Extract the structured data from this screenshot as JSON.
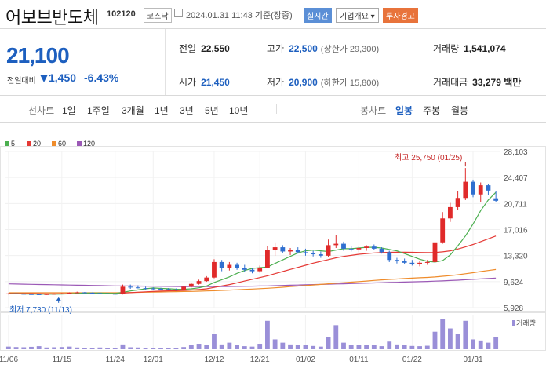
{
  "header": {
    "name": "어보브반도체",
    "code": "102120",
    "market": "코스닥",
    "datetime": "2024.01.31 11:43 기준(장중)",
    "realtime_label": "실시간",
    "company_label": "기업개요 ▾",
    "warning_label": "투자경고"
  },
  "quote": {
    "price": "21,100",
    "change_label": "전일대비",
    "change_value": "1,450",
    "change_pct": "-6.43%",
    "prev_label": "전일",
    "prev_value": "22,550",
    "high_label": "고가",
    "high_value": "22,500",
    "high_sub": "(상한가 29,300)",
    "volume_label": "거래량",
    "volume_value": "1,541,074",
    "open_label": "시가",
    "open_value": "21,450",
    "low_label": "저가",
    "low_value": "20,900",
    "low_sub": "(하한가 15,800)",
    "amount_label": "거래대금",
    "amount_value": "33,279 백만"
  },
  "tabs": {
    "line_label": "선차트",
    "periods": [
      "1일",
      "1주일",
      "3개월",
      "1년",
      "3년",
      "5년",
      "10년"
    ],
    "candle_label": "봉차트",
    "candle_types": [
      "일봉",
      "주봉",
      "월봉"
    ],
    "active_candle": "일봉"
  },
  "chart_data": {
    "type": "candlestick",
    "legend": [
      {
        "name": "5",
        "color": "#4caf50"
      },
      {
        "name": "20",
        "color": "#e53935"
      },
      {
        "name": "60",
        "color": "#ef8c2b"
      },
      {
        "name": "120",
        "color": "#9b59b6"
      }
    ],
    "y_ticks": [
      "28,103",
      "24,407",
      "20,711",
      "17,016",
      "13,320",
      "9,624",
      "5,928"
    ],
    "ylim": [
      5928,
      28103
    ],
    "x_ticks": [
      "11/06",
      "11/15",
      "11/24",
      "12/01",
      "12/12",
      "12/21",
      "01/02",
      "01/11",
      "01/22",
      "01/31"
    ],
    "volume_label": "거래량",
    "annotation_high": "최고 25,750 (01/25)",
    "annotation_low": "최저 7,730 (11/13)",
    "candles": [
      [
        7900,
        8000,
        7800,
        7950
      ],
      [
        7950,
        8000,
        7850,
        7900
      ],
      [
        7900,
        7950,
        7800,
        7850
      ],
      [
        7850,
        7900,
        7780,
        7830
      ],
      [
        7830,
        7880,
        7730,
        7800
      ],
      [
        7800,
        7900,
        7750,
        7850
      ],
      [
        7850,
        7950,
        7800,
        7900
      ],
      [
        7900,
        8000,
        7850,
        7950
      ],
      [
        7950,
        8100,
        7900,
        8050
      ],
      [
        8050,
        8200,
        8000,
        8100
      ],
      [
        8100,
        8150,
        8000,
        8050
      ],
      [
        8050,
        8100,
        7950,
        8000
      ],
      [
        8000,
        8050,
        7900,
        7950
      ],
      [
        7950,
        8000,
        7850,
        7900
      ],
      [
        7900,
        7950,
        7800,
        7850
      ],
      [
        7850,
        9200,
        7800,
        8900
      ],
      [
        8900,
        9200,
        8600,
        8800
      ],
      [
        8800,
        9100,
        8650,
        8700
      ],
      [
        8700,
        8900,
        8500,
        8650
      ],
      [
        8650,
        8800,
        8500,
        8600
      ],
      [
        8600,
        8750,
        8450,
        8550
      ],
      [
        8550,
        8700,
        8400,
        8500
      ],
      [
        8500,
        8650,
        8350,
        8450
      ],
      [
        8450,
        9000,
        8400,
        8900
      ],
      [
        8900,
        9500,
        8800,
        9300
      ],
      [
        9300,
        9900,
        9200,
        9700
      ],
      [
        9700,
        10400,
        9600,
        10200
      ],
      [
        10200,
        12800,
        10100,
        12400
      ],
      [
        12400,
        12700,
        11100,
        11500
      ],
      [
        11500,
        12400,
        11200,
        12000
      ],
      [
        12000,
        12300,
        11300,
        11600
      ],
      [
        11600,
        12000,
        11000,
        11300
      ],
      [
        11300,
        11600,
        10800,
        11100
      ],
      [
        11100,
        11900,
        10900,
        11600
      ],
      [
        11600,
        14700,
        11500,
        14100
      ],
      [
        14100,
        15200,
        13300,
        14500
      ],
      [
        14500,
        14800,
        13700,
        13900
      ],
      [
        13900,
        14400,
        13400,
        14100
      ],
      [
        14100,
        14500,
        13600,
        13800
      ],
      [
        13800,
        14300,
        13300,
        13700
      ],
      [
        13700,
        14000,
        13200,
        13500
      ],
      [
        13500,
        13900,
        13000,
        13300
      ],
      [
        13300,
        15600,
        13100,
        14800
      ],
      [
        14800,
        16200,
        14400,
        15000
      ],
      [
        15000,
        15300,
        14000,
        14300
      ],
      [
        14300,
        14700,
        13900,
        14200
      ],
      [
        14200,
        14600,
        13800,
        14400
      ],
      [
        14400,
        14800,
        14000,
        14600
      ],
      [
        14600,
        14900,
        14100,
        14300
      ],
      [
        14300,
        14500,
        13600,
        13800
      ],
      [
        13800,
        14000,
        12400,
        12700
      ],
      [
        12700,
        13000,
        12200,
        12500
      ],
      [
        12500,
        12900,
        12100,
        12300
      ],
      [
        12300,
        12700,
        11900,
        12100
      ],
      [
        12100,
        12600,
        11800,
        12300
      ],
      [
        12300,
        12700,
        12000,
        12400
      ],
      [
        12400,
        15600,
        12200,
        15200
      ],
      [
        15200,
        19500,
        15000,
        18600
      ],
      [
        18600,
        20800,
        18100,
        20200
      ],
      [
        20200,
        22500,
        19800,
        21500
      ],
      [
        21500,
        25750,
        21200,
        23800
      ],
      [
        23800,
        24100,
        21600,
        22000
      ],
      [
        22000,
        23700,
        20900,
        23300
      ],
      [
        23300,
        23500,
        21900,
        22550
      ],
      [
        21450,
        22500,
        20900,
        21100
      ]
    ],
    "ma5": [
      7900,
      7900,
      7880,
      7870,
      7850,
      7840,
      7845,
      7860,
      7900,
      7960,
      8000,
      8010,
      8000,
      7980,
      7950,
      8100,
      8300,
      8450,
      8600,
      8730,
      8660,
      8610,
      8550,
      8540,
      8600,
      8750,
      9000,
      9500,
      9900,
      10300,
      10800,
      11200,
      11500,
      11600,
      11700,
      12200,
      12700,
      13200,
      13700,
      14000,
      14100,
      14000,
      13900,
      14100,
      14300,
      14300,
      14400,
      14500,
      14500,
      14400,
      14200,
      14000,
      13600,
      13200,
      12800,
      12500,
      12400,
      12600,
      13400,
      14700,
      16100,
      17800,
      19700,
      21200,
      22300
    ],
    "ma20": [
      7950,
      7940,
      7930,
      7920,
      7910,
      7900,
      7900,
      7900,
      7910,
      7920,
      7930,
      7940,
      7950,
      7950,
      7950,
      8000,
      8060,
      8120,
      8180,
      8240,
      8280,
      8310,
      8340,
      8380,
      8430,
      8500,
      8600,
      8800,
      9000,
      9200,
      9450,
      9700,
      9950,
      10200,
      10450,
      10750,
      11050,
      11350,
      11650,
      11950,
      12250,
      12500,
      12750,
      13000,
      13200,
      13350,
      13500,
      13600,
      13700,
      13750,
      13780,
      13800,
      13800,
      13780,
      13760,
      13740,
      13760,
      13850,
      14000,
      14250,
      14550,
      14900,
      15300,
      15700,
      16100
    ],
    "ma60": [
      8050,
      8050,
      8050,
      8045,
      8040,
      8040,
      8040,
      8040,
      8040,
      8040,
      8045,
      8050,
      8050,
      8050,
      8050,
      8060,
      8080,
      8100,
      8120,
      8140,
      8160,
      8180,
      8200,
      8220,
      8240,
      8270,
      8300,
      8340,
      8380,
      8420,
      8470,
      8520,
      8570,
      8620,
      8680,
      8750,
      8830,
      8910,
      8990,
      9070,
      9150,
      9230,
      9310,
      9390,
      9470,
      9550,
      9630,
      9710,
      9790,
      9870,
      9940,
      10000,
      10060,
      10120,
      10170,
      10220,
      10290,
      10380,
      10480,
      10600,
      10740,
      10890,
      11050,
      11200,
      11340
    ],
    "ma120": [
      9300,
      9280,
      9260,
      9240,
      9220,
      9200,
      9180,
      9160,
      9140,
      9120,
      9100,
      9080,
      9060,
      9040,
      9020,
      9010,
      9000,
      8990,
      8980,
      8970,
      8960,
      8950,
      8940,
      8930,
      8920,
      8920,
      8920,
      8920,
      8930,
      8940,
      8950,
      8960,
      8980,
      9000,
      9020,
      9050,
      9080,
      9110,
      9140,
      9170,
      9200,
      9230,
      9260,
      9290,
      9320,
      9350,
      9380,
      9410,
      9440,
      9470,
      9500,
      9530,
      9560,
      9590,
      9620,
      9650,
      9690,
      9730,
      9780,
      9830,
      9890,
      9950,
      10010,
      10070,
      10130
    ],
    "volumes": [
      12,
      10,
      9,
      11,
      14,
      8,
      9,
      10,
      12,
      8,
      7,
      6,
      8,
      7,
      6,
      22,
      9,
      8,
      7,
      6,
      5,
      6,
      5,
      10,
      18,
      25,
      20,
      70,
      22,
      30,
      18,
      14,
      12,
      25,
      130,
      45,
      30,
      22,
      20,
      18,
      15,
      12,
      55,
      110,
      30,
      20,
      18,
      20,
      18,
      14,
      35,
      22,
      18,
      15,
      14,
      16,
      80,
      140,
      95,
      70,
      130,
      45,
      40,
      30,
      55
    ]
  }
}
